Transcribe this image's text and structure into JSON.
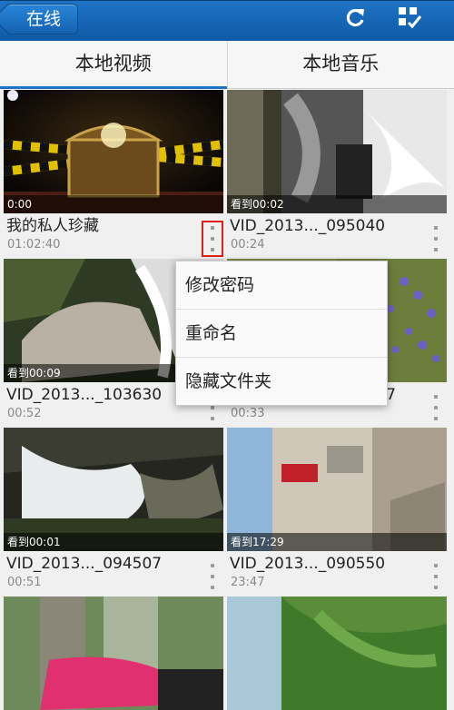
{
  "topbar": {
    "back_label": "在线",
    "refresh_icon": "refresh-icon",
    "select_icon": "checklist-icon"
  },
  "tabs": [
    {
      "label": "本地视频",
      "active": true
    },
    {
      "label": "本地音乐",
      "active": false
    }
  ],
  "videos": [
    {
      "overlay": "0:00",
      "title": "我的私人珍藏",
      "duration": "01:02:40"
    },
    {
      "overlay": "看到00:02",
      "title": "VID_2013..._095040",
      "duration": "00:24"
    },
    {
      "overlay": "看到00:09",
      "title": "VID_2013..._103630",
      "duration": "00:52"
    },
    {
      "overlay": "",
      "title": "7",
      "duration": "00:33"
    },
    {
      "overlay": "看到00:01",
      "title": "VID_2013..._094507",
      "duration": "00:51"
    },
    {
      "overlay": "看到17:29",
      "title": "VID_2013..._090550",
      "duration": "23:47"
    }
  ],
  "context_menu": [
    "修改密码",
    "重命名",
    "隐藏文件夹"
  ]
}
